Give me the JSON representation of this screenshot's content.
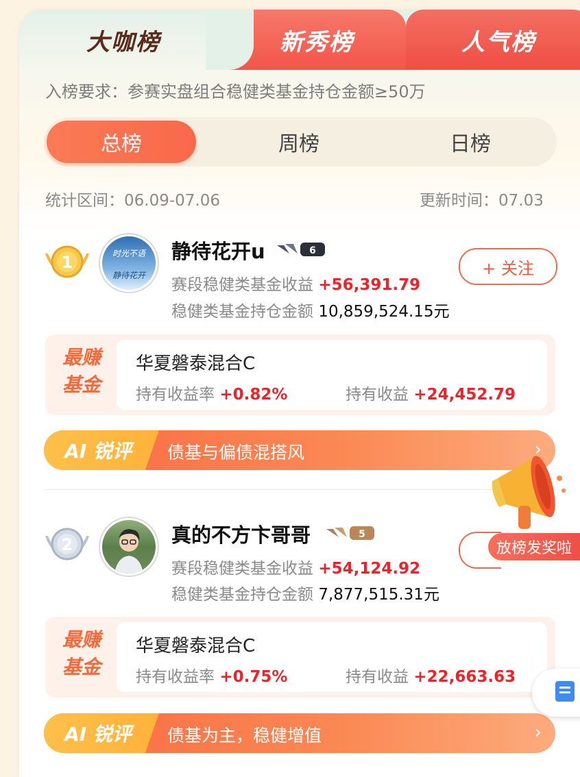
{
  "tabs": [
    "大咖榜",
    "新秀榜",
    "人气榜"
  ],
  "requirement": "入榜要求：参赛实盘组合稳健类基金持仓金额≥50万",
  "period_tabs": [
    "总榜",
    "周榜",
    "日榜"
  ],
  "stat_range": "统计区间：06.09-07.06",
  "update_time": "更新时间：07.03",
  "entries": [
    {
      "rank": "1",
      "avatar_text": [
        "时光不语",
        "静待花开"
      ],
      "name": "静待花开u",
      "level": "6",
      "gain_label": "赛段稳健类基金收益",
      "gain": "+56,391.79",
      "holding_label": "稳健类基金持仓金额",
      "holding": "10,859,524.15元",
      "follow": "+ 关注",
      "fund_tag": [
        "最赚",
        "基金"
      ],
      "fund_name": "华夏磐泰混合C",
      "rate_label": "持有收益率",
      "rate": "+0.82%",
      "profit_label": "持有收益",
      "profit": "+24,452.79",
      "ai_tag": "AI 锐评",
      "ai_comment": "债基与偏债混搭风"
    },
    {
      "rank": "2",
      "name": "真的不方卞哥哥",
      "level": "5",
      "gain_label": "赛段稳健类基金收益",
      "gain": "+54,124.92",
      "holding_label": "稳健类基金持仓金额",
      "holding": "7,877,515.31元",
      "fund_tag": [
        "最赚",
        "基金"
      ],
      "fund_name": "华夏磐泰混合C",
      "rate_label": "持有收益率",
      "rate": "+0.75%",
      "profit_label": "持有收益",
      "profit": "+22,663.63",
      "ai_tag": "AI 锐评",
      "ai_comment": "债基为主，稳健增值"
    }
  ],
  "promo_label": "放榜发奖啦",
  "colors": {
    "accent": "#f8694a",
    "red_value": "#e8262a",
    "tab_red": "#f3554a",
    "ai_orange": "#f96a43",
    "ai_gold": "#ffb23a"
  }
}
